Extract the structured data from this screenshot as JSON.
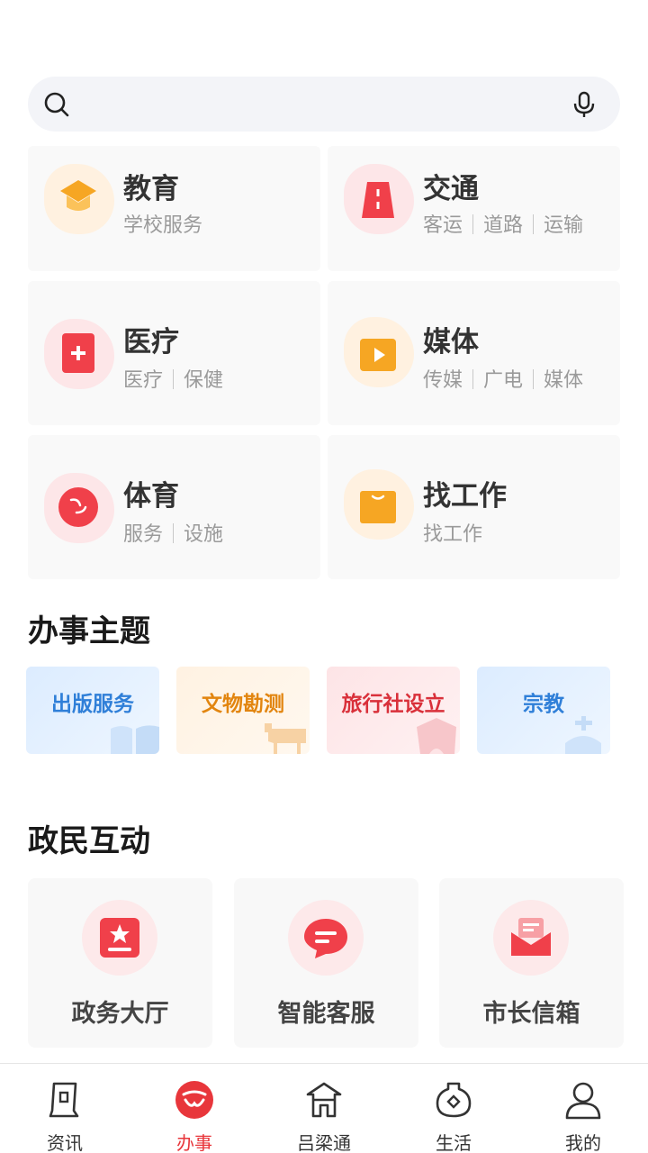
{
  "search": {
    "placeholder": ""
  },
  "services": [
    {
      "title": "教育",
      "tags": [
        "学校服务"
      ],
      "icon": "graduation-cap-icon",
      "color": "#f6a623"
    },
    {
      "title": "交通",
      "tags": [
        "客运",
        "道路",
        "运输"
      ],
      "icon": "road-icon",
      "color": "#f0404a"
    },
    {
      "title": "医疗",
      "tags": [
        "医疗",
        "保健"
      ],
      "icon": "medical-cross-icon",
      "color": "#f0404a"
    },
    {
      "title": "媒体",
      "tags": [
        "传媒",
        "广电",
        "媒体"
      ],
      "icon": "play-icon",
      "color": "#f6a623"
    },
    {
      "title": "体育",
      "tags": [
        "服务",
        "设施"
      ],
      "icon": "ball-icon",
      "color": "#f0404a"
    },
    {
      "title": "找工作",
      "tags": [
        "找工作"
      ],
      "icon": "briefcase-icon",
      "color": "#f6a623"
    }
  ],
  "topics_section": {
    "title": "办事主题"
  },
  "topics": [
    {
      "label": "出版服务",
      "color": "#2f7fd8",
      "icon": "book-icon"
    },
    {
      "label": "文物勘测",
      "color": "#e2850f",
      "icon": "artifact-icon"
    },
    {
      "label": "旅行社设立",
      "color": "#d9303a",
      "icon": "building-icon"
    },
    {
      "label": "宗教",
      "color": "#2f7fd8",
      "icon": "church-icon"
    }
  ],
  "interaction_section": {
    "title": "政民互动"
  },
  "interactions": [
    {
      "label": "政务大厅",
      "icon": "hall-icon"
    },
    {
      "label": "智能客服",
      "icon": "chat-icon"
    },
    {
      "label": "市长信箱",
      "icon": "mailbox-icon"
    }
  ],
  "nav": [
    {
      "label": "资讯",
      "icon": "news-icon",
      "active": false
    },
    {
      "label": "办事",
      "icon": "affairs-icon",
      "active": true
    },
    {
      "label": "吕梁通",
      "icon": "gate-icon",
      "active": false
    },
    {
      "label": "生活",
      "icon": "life-icon",
      "active": false
    },
    {
      "label": "我的",
      "icon": "user-icon",
      "active": false
    }
  ],
  "colors": {
    "accent": "#e8363b",
    "orange": "#f6a623",
    "blue": "#2f7fd8"
  }
}
